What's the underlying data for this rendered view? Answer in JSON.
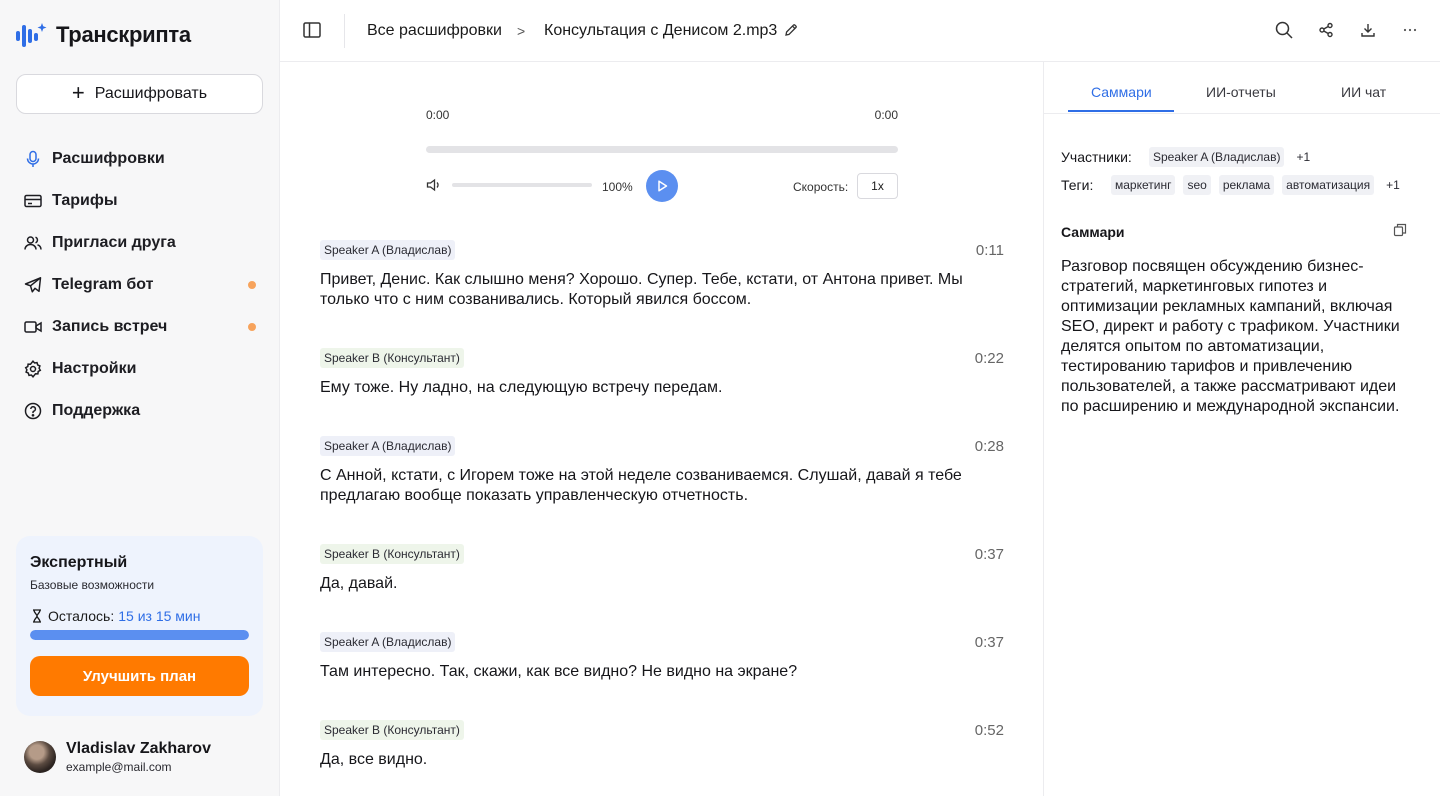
{
  "app": {
    "name": "Транскрипта"
  },
  "sidebar": {
    "new_button_label": "Расшифровать",
    "items": [
      {
        "label": "Расшифровки",
        "icon": "mic-icon"
      },
      {
        "label": "Тарифы",
        "icon": "card-icon"
      },
      {
        "label": "Пригласи друга",
        "icon": "users-icon"
      },
      {
        "label": "Telegram бот",
        "icon": "telegram-icon",
        "dot": true
      },
      {
        "label": "Запись встреч",
        "icon": "video-icon",
        "dot": true
      },
      {
        "label": "Настройки",
        "icon": "gear-icon"
      },
      {
        "label": "Поддержка",
        "icon": "help-icon"
      }
    ],
    "plan": {
      "title": "Экспертный",
      "subtitle": "Базовые возможности",
      "left_label": "Осталось:",
      "left_value": "15 из 15 мин",
      "progress": 1.0,
      "upgrade_label": "Улучшить план"
    },
    "user": {
      "name": "Vladislav Zakharov",
      "email": "example@mail.com"
    }
  },
  "header": {
    "breadcrumb_root": "Все расшифровки",
    "breadcrumb_sep": ">",
    "file_name": "Консультация с Денисом 2.mp3"
  },
  "player": {
    "current_time": "0:00",
    "total_time": "0:00",
    "progress": 0,
    "volume_percent": "100%",
    "speed_label": "Скорость:",
    "speed_value": "1x"
  },
  "transcript": [
    {
      "speaker": "Speaker A (Владислав)",
      "who": "a",
      "time": "0:11",
      "text": "Привет, Денис. Как слышно меня? Хорошо. Супер. Тебе, кстати, от Антона привет. Мы только что с ним созванивались. Который явился боссом."
    },
    {
      "speaker": "Speaker B (Консультант)",
      "who": "b",
      "time": "0:22",
      "text": "Ему тоже. Ну ладно, на следующую встречу передам."
    },
    {
      "speaker": "Speaker A (Владислав)",
      "who": "a",
      "time": "0:28",
      "text": "С Анной, кстати, с Игорем тоже на этой неделе созваниваемся. Слушай, давай я тебе предлагаю вообще показать управленческую отчетность."
    },
    {
      "speaker": "Speaker B (Консультант)",
      "who": "b",
      "time": "0:37",
      "text": "Да, давай."
    },
    {
      "speaker": "Speaker A (Владислав)",
      "who": "a",
      "time": "0:37",
      "text": "Там интересно. Так, скажи, как все видно? Не видно на экране?"
    },
    {
      "speaker": "Speaker B (Консультант)",
      "who": "b",
      "time": "0:52",
      "text": "Да, все видно."
    }
  ],
  "panel": {
    "tabs": [
      "Саммари",
      "ИИ-отчеты",
      "ИИ чат"
    ],
    "participants_label": "Участники:",
    "participants": [
      "Speaker A (Владислав)"
    ],
    "participants_more": "+1",
    "tags_label": "Теги:",
    "tags": [
      "маркетинг",
      "seo",
      "реклама",
      "автоматизация"
    ],
    "tags_more": "+1",
    "summary_title": "Саммари",
    "summary_text": "Разговор посвящен обсуждению бизнес-стратегий, маркетинговых гипотез и оптимизации рекламных кампаний, включая SEO, директ и работу с трафиком. Участники делятся опытом по автоматизации, тестированию тарифов и привлечению пользователей, а также рассматривают идеи по расширению и международной экспансии."
  },
  "colors": {
    "accent": "#2f6ee6",
    "play": "#5b8ff0",
    "upgrade": "#ff7a00",
    "dot": "#f7a35c"
  }
}
